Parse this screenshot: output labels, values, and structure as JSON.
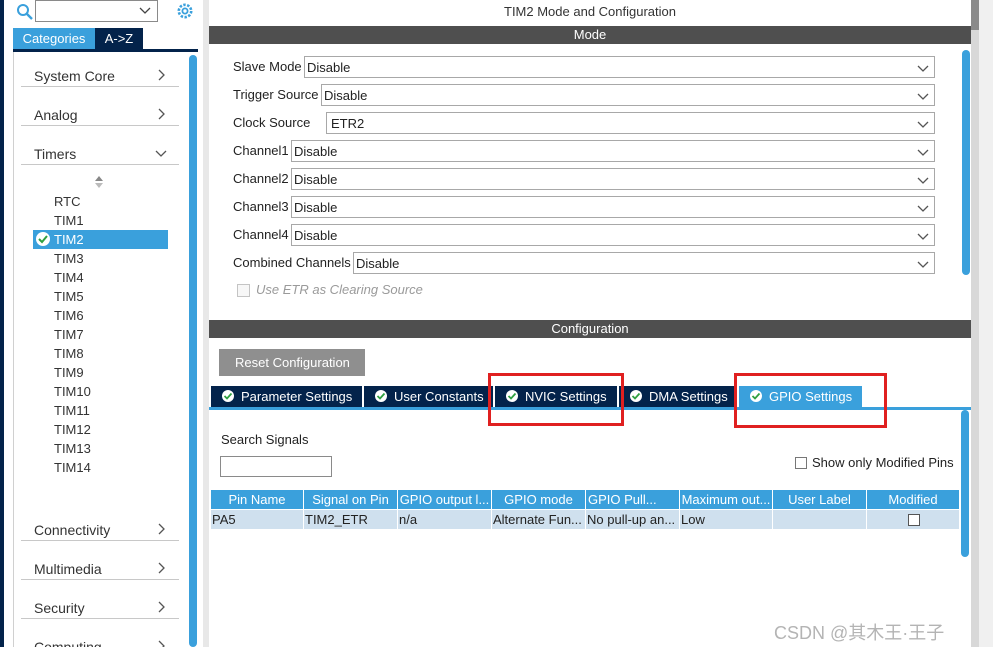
{
  "left_panel": {
    "tabs": {
      "categories": "Categories",
      "az": "A->Z"
    },
    "categories_top": [
      {
        "label": "System Core"
      },
      {
        "label": "Analog"
      },
      {
        "label": "Timers"
      }
    ],
    "timers": [
      "RTC",
      "TIM1",
      "TIM2",
      "TIM3",
      "TIM4",
      "TIM5",
      "TIM6",
      "TIM7",
      "TIM8",
      "TIM9",
      "TIM10",
      "TIM11",
      "TIM12",
      "TIM13",
      "TIM14"
    ],
    "selected_timer": "TIM2",
    "categories_bottom": [
      {
        "label": "Connectivity"
      },
      {
        "label": "Multimedia"
      },
      {
        "label": "Security"
      },
      {
        "label": "Computing"
      }
    ],
    "icons": {
      "search": "search-icon",
      "settings": "gear-icon",
      "expand": "chevron-right-icon",
      "collapse": "chevron-down-icon"
    }
  },
  "main": {
    "title": "TIM2 Mode and Configuration",
    "mode_bar": "Mode",
    "mode_rows": [
      {
        "label": "Slave Mode",
        "value": "Disable"
      },
      {
        "label": "Trigger Source",
        "value": "Disable"
      },
      {
        "label": "Clock Source",
        "value": "ETR2"
      },
      {
        "label": "Channel1",
        "value": "Disable"
      },
      {
        "label": "Channel2",
        "value": "Disable"
      },
      {
        "label": "Channel3",
        "value": "Disable"
      },
      {
        "label": "Channel4",
        "value": "Disable"
      },
      {
        "label": "Combined Channels",
        "value": "Disable"
      }
    ],
    "etr_checkbox": "Use ETR as Clearing Source",
    "config_bar": "Configuration",
    "reset_button": "Reset Configuration",
    "tabs": [
      {
        "label": "Parameter Settings"
      },
      {
        "label": "User Constants"
      },
      {
        "label": "NVIC Settings"
      },
      {
        "label": "DMA Settings"
      },
      {
        "label": "GPIO Settings"
      }
    ],
    "active_tab": "GPIO Settings",
    "search_label": "Search Signals",
    "search_value": "",
    "show_modified_label": "Show only Modified Pins",
    "table": {
      "headers": [
        "Pin Name",
        "Signal on Pin",
        "GPIO output l...",
        "GPIO mode",
        "GPIO Pull...",
        "Maximum out...",
        "User Label",
        "Modified"
      ],
      "rows": [
        [
          "PA5",
          "TIM2_ETR",
          "n/a",
          "Alternate Fun...",
          "No pull-up an...",
          "Low",
          "",
          ""
        ]
      ]
    }
  },
  "watermark": "CSDN @其木王·王子",
  "colors": {
    "accent": "#3aa0dc",
    "navy": "#03234b",
    "highlight_red": "#e02020",
    "bar_gray": "#4f4f4f"
  }
}
